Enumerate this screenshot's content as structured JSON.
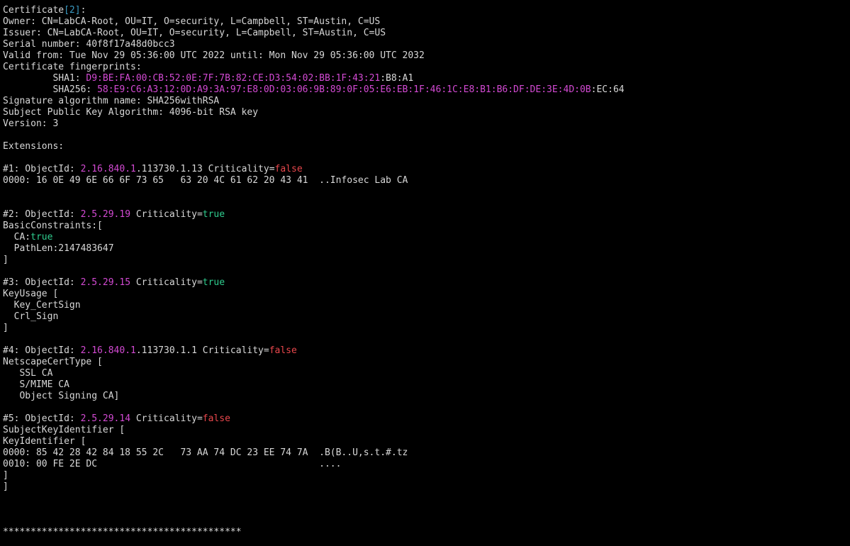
{
  "colors": {
    "background": "#000000",
    "foreground": "#d8d8d8",
    "cyan": "#3a9bc4",
    "magenta": "#d34ad3",
    "red": "#e8474c",
    "green": "#2fce8f"
  },
  "terminal": {
    "lines": [
      {
        "name": "certificate-header",
        "segs": [
          {
            "t": "Certificate",
            "c": "default"
          },
          {
            "t": "[2]",
            "c": "cyan"
          },
          {
            "t": ":",
            "c": "default"
          }
        ]
      },
      {
        "name": "owner-line",
        "segs": [
          {
            "t": "Owner: CN=LabCA-Root, OU=IT, O=security, L=Campbell, ST=Austin, C=US",
            "c": "default"
          }
        ]
      },
      {
        "name": "issuer-line",
        "segs": [
          {
            "t": "Issuer: CN=LabCA-Root, OU=IT, O=security, L=Campbell, ST=Austin, C=US",
            "c": "default"
          }
        ]
      },
      {
        "name": "serial-line",
        "segs": [
          {
            "t": "Serial number: 40f8f17a48d0bcc3",
            "c": "default"
          }
        ]
      },
      {
        "name": "validity-line",
        "segs": [
          {
            "t": "Valid from: Tue Nov 29 05:36:00 UTC 2022 until: Mon Nov 29 05:36:00 UTC 2032",
            "c": "default"
          }
        ]
      },
      {
        "name": "fingerprints-header",
        "segs": [
          {
            "t": "Certificate fingerprints:",
            "c": "default"
          }
        ]
      },
      {
        "name": "sha1-line",
        "segs": [
          {
            "t": "         SHA1: ",
            "c": "default"
          },
          {
            "t": "D9:BE:FA:00:CB:52:0E:7F:7B:82:CE:D3:54:02:BB:1F:43:21",
            "c": "magenta"
          },
          {
            "t": ":B8:A1",
            "c": "default"
          }
        ]
      },
      {
        "name": "sha256-line",
        "segs": [
          {
            "t": "         SHA256: ",
            "c": "default"
          },
          {
            "t": "58:E9:C6:A3:12:0D:A9:3A:97:E8:0D:03:06:9B:89:0F:05:E6:EB:1F:46:1C:E8:B1:B6:DF:DE:3E:4D:0B",
            "c": "magenta"
          },
          {
            "t": ":EC:64",
            "c": "default"
          }
        ]
      },
      {
        "name": "signature-algorithm-line",
        "segs": [
          {
            "t": "Signature algorithm name: SHA256withRSA",
            "c": "default"
          }
        ]
      },
      {
        "name": "public-key-line",
        "segs": [
          {
            "t": "Subject Public Key Algorithm: 4096-bit RSA key",
            "c": "default"
          }
        ]
      },
      {
        "name": "version-line",
        "segs": [
          {
            "t": "Version: 3",
            "c": "default"
          }
        ]
      },
      {
        "name": "blank-line",
        "segs": []
      },
      {
        "name": "extensions-header",
        "segs": [
          {
            "t": "Extensions:",
            "c": "default"
          }
        ]
      },
      {
        "name": "blank-line",
        "segs": []
      },
      {
        "name": "ext1-header",
        "segs": [
          {
            "t": "#1: ObjectId: ",
            "c": "default"
          },
          {
            "t": "2.16.840.1",
            "c": "magenta"
          },
          {
            "t": ".113730.1.13 Criticality=",
            "c": "default"
          },
          {
            "t": "false",
            "c": "red"
          }
        ]
      },
      {
        "name": "ext1-hex-line",
        "segs": [
          {
            "t": "0000: 16 0E 49 6E 66 6F 73 65   63 20 4C 61 62 20 43 41  ..Infosec Lab CA",
            "c": "default"
          }
        ]
      },
      {
        "name": "blank-line",
        "segs": []
      },
      {
        "name": "blank-line",
        "segs": []
      },
      {
        "name": "ext2-header",
        "segs": [
          {
            "t": "#2: ObjectId: ",
            "c": "default"
          },
          {
            "t": "2.5.29.19",
            "c": "magenta"
          },
          {
            "t": " Criticality=",
            "c": "default"
          },
          {
            "t": "true",
            "c": "green"
          }
        ]
      },
      {
        "name": "basic-constraints-open",
        "segs": [
          {
            "t": "BasicConstraints:[",
            "c": "default"
          }
        ]
      },
      {
        "name": "ca-flag-line",
        "segs": [
          {
            "t": "  CA:",
            "c": "default"
          },
          {
            "t": "true",
            "c": "green"
          }
        ]
      },
      {
        "name": "pathlen-line",
        "segs": [
          {
            "t": "  PathLen:2147483647",
            "c": "default"
          }
        ]
      },
      {
        "name": "bracket-close",
        "segs": [
          {
            "t": "]",
            "c": "default"
          }
        ]
      },
      {
        "name": "blank-line",
        "segs": []
      },
      {
        "name": "ext3-header",
        "segs": [
          {
            "t": "#3: ObjectId: ",
            "c": "default"
          },
          {
            "t": "2.5.29.15",
            "c": "magenta"
          },
          {
            "t": " Criticality=",
            "c": "default"
          },
          {
            "t": "true",
            "c": "green"
          }
        ]
      },
      {
        "name": "key-usage-open",
        "segs": [
          {
            "t": "KeyUsage [",
            "c": "default"
          }
        ]
      },
      {
        "name": "key-certsign-line",
        "segs": [
          {
            "t": "  Key_CertSign",
            "c": "default"
          }
        ]
      },
      {
        "name": "crl-sign-line",
        "segs": [
          {
            "t": "  Crl_Sign",
            "c": "default"
          }
        ]
      },
      {
        "name": "bracket-close",
        "segs": [
          {
            "t": "]",
            "c": "default"
          }
        ]
      },
      {
        "name": "blank-line",
        "segs": []
      },
      {
        "name": "ext4-header",
        "segs": [
          {
            "t": "#4: ObjectId: ",
            "c": "default"
          },
          {
            "t": "2.16.840.1",
            "c": "magenta"
          },
          {
            "t": ".113730.1.1 Criticality=",
            "c": "default"
          },
          {
            "t": "false",
            "c": "red"
          }
        ]
      },
      {
        "name": "netscape-cert-type-open",
        "segs": [
          {
            "t": "NetscapeCertType [",
            "c": "default"
          }
        ]
      },
      {
        "name": "ssl-ca-line",
        "segs": [
          {
            "t": "   SSL CA",
            "c": "default"
          }
        ]
      },
      {
        "name": "smime-ca-line",
        "segs": [
          {
            "t": "   S/MIME CA",
            "c": "default"
          }
        ]
      },
      {
        "name": "object-signing-ca-line",
        "segs": [
          {
            "t": "   Object Signing CA]",
            "c": "default"
          }
        ]
      },
      {
        "name": "blank-line",
        "segs": []
      },
      {
        "name": "ext5-header",
        "segs": [
          {
            "t": "#5: ObjectId: ",
            "c": "default"
          },
          {
            "t": "2.5.29.14",
            "c": "magenta"
          },
          {
            "t": " Criticality=",
            "c": "default"
          },
          {
            "t": "false",
            "c": "red"
          }
        ]
      },
      {
        "name": "subject-key-identifier-open",
        "segs": [
          {
            "t": "SubjectKeyIdentifier [",
            "c": "default"
          }
        ]
      },
      {
        "name": "key-identifier-open",
        "segs": [
          {
            "t": "KeyIdentifier [",
            "c": "default"
          }
        ]
      },
      {
        "name": "ext5-hex-line-0000",
        "segs": [
          {
            "t": "0000: 85 42 28 42 84 18 55 2C   73 AA 74 DC 23 EE 74 7A  .B(B..U,s.t.#.tz",
            "c": "default"
          }
        ]
      },
      {
        "name": "ext5-hex-line-0010",
        "segs": [
          {
            "t": "0010: 00 FE 2E DC                                        ....",
            "c": "default"
          }
        ]
      },
      {
        "name": "bracket-close",
        "segs": [
          {
            "t": "]",
            "c": "default"
          }
        ]
      },
      {
        "name": "bracket-close",
        "segs": [
          {
            "t": "]",
            "c": "default"
          }
        ]
      },
      {
        "name": "blank-line",
        "segs": []
      },
      {
        "name": "blank-line",
        "segs": []
      },
      {
        "name": "blank-line",
        "segs": []
      },
      {
        "name": "separator-line",
        "segs": [
          {
            "t": "*******************************************",
            "c": "default"
          }
        ]
      }
    ]
  }
}
